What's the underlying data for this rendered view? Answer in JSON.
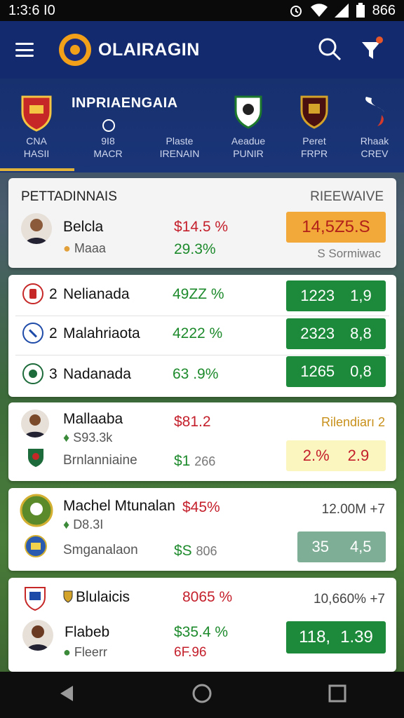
{
  "status": {
    "time": "1:3:6 I0",
    "battery": "866"
  },
  "app": {
    "title": "OLAIRAGIN"
  },
  "league": {
    "title": "INPRIAENGAIA",
    "tabs": [
      {
        "line1": "CNA",
        "line2": "HASII"
      },
      {
        "line1": "9I8",
        "line2": "MACR"
      },
      {
        "line1": "Plaste",
        "line2": "IRENAIN"
      },
      {
        "line1": "Aeadue",
        "line2": "PUNIR"
      },
      {
        "line1": "Peret",
        "line2": "FRPR"
      },
      {
        "line1": "Rhaak",
        "line2": "CREV"
      }
    ]
  },
  "card1": {
    "heading": "PETTADINNAIS",
    "right_heading": "RIEEWAIVE",
    "name": "Belcla",
    "sub": "Maaa",
    "pct": "$14.5 %",
    "change": "29.3%",
    "badge": "14,5Z5.S",
    "foot": "S Sormiwac"
  },
  "card2": {
    "rows": [
      {
        "rank": "2",
        "name": "Nelianada",
        "pct": "49ZZ %",
        "v1": "1223",
        "v2": "1,9"
      },
      {
        "rank": "2",
        "name": "Malahriaota",
        "pct": "4222 %",
        "v1": "2323",
        "v2": "8,8"
      },
      {
        "rank": "3",
        "name": "Nadanada",
        "pct": "63 .9%",
        "v1": "1265",
        "v2": "0,8"
      }
    ]
  },
  "card3": {
    "name": "Mallaaba",
    "sub": "S93.3k",
    "name2": "Brnlanniaine",
    "price": "$81.2",
    "val": "$1",
    "val_sub": "266",
    "right": "Rilendiarı 2",
    "b1": "2.%",
    "b2": "2.9"
  },
  "card4": {
    "name": "Machel Mtunalan",
    "sub": "D8.3I",
    "name2": "Smganalaon",
    "price": "$45%",
    "val": "$S",
    "val_sub": "806",
    "right": "12.00M +7",
    "b1": "35",
    "b2": "4,5"
  },
  "card5": {
    "name": "Blulaicis",
    "price": "8065 %",
    "right": "10,660% +7",
    "name2": "Flabeb",
    "sub": "Fleerr",
    "price2": "$35.4 %",
    "val": "6F.96",
    "b1": "118,",
    "b2": "1.39"
  },
  "colors": {
    "primary": "#142a6e",
    "accent": "#f2a01a",
    "positive": "#1d8a2c",
    "negative": "#c4202c"
  }
}
